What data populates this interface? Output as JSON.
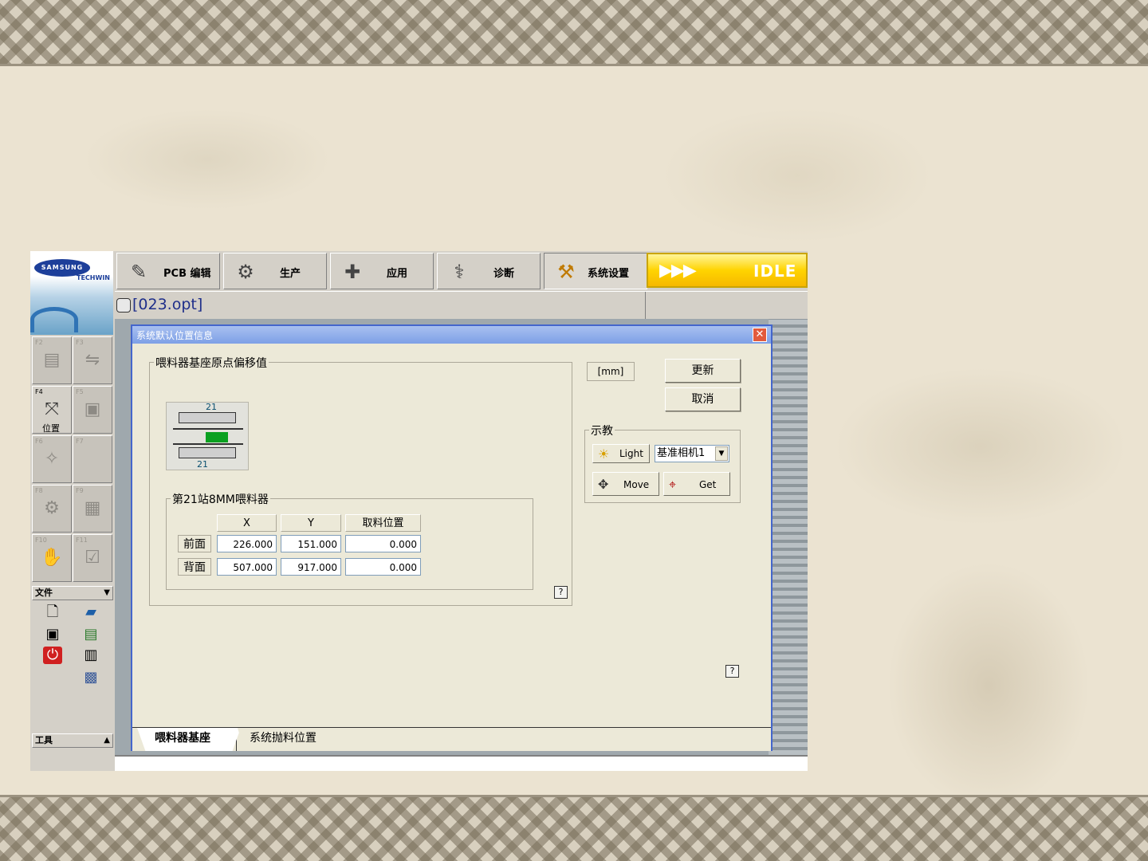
{
  "app": {
    "logo_brand": "SAMSUNG",
    "logo_sub": "TECHWIN",
    "file_name": "[023.opt]",
    "status": "IDLE"
  },
  "toolbar": {
    "items": [
      {
        "label": "PCB 编辑",
        "icon": "pcb-edit-icon"
      },
      {
        "label": "生产",
        "icon": "production-icon"
      },
      {
        "label": "应用",
        "icon": "application-icon"
      },
      {
        "label": "诊断",
        "icon": "diagnostics-icon"
      },
      {
        "label": "系统设置",
        "icon": "system-settings-icon"
      }
    ]
  },
  "fkeys": [
    {
      "key": "F2",
      "label": ""
    },
    {
      "key": "F3",
      "label": ""
    },
    {
      "key": "F4",
      "label": "位置"
    },
    {
      "key": "F5",
      "label": ""
    },
    {
      "key": "F6",
      "label": ""
    },
    {
      "key": "F7",
      "label": ""
    },
    {
      "key": "F8",
      "label": ""
    },
    {
      "key": "F9",
      "label": ""
    },
    {
      "key": "F10",
      "label": ""
    },
    {
      "key": "F11",
      "label": ""
    }
  ],
  "menus": {
    "file": "文件",
    "tools": "工具"
  },
  "dialog": {
    "title": "系统默认位置信息",
    "group_title": "喂料器基座原点偏移值",
    "diagram_label_top": "21",
    "diagram_label_bottom": "21",
    "station_group_title": "第21站8MM喂料器",
    "columns": [
      "X",
      "Y",
      "取料位置"
    ],
    "rows": [
      {
        "label": "前面",
        "x": "226.000",
        "y": "151.000",
        "pick": "0.000"
      },
      {
        "label": "背面",
        "x": "507.000",
        "y": "917.000",
        "pick": "0.000"
      }
    ],
    "unit": "[mm]",
    "update_button": "更新",
    "cancel_button": "取消",
    "teach_group": "示教",
    "light_button": "Light",
    "camera_select": "基准相机1",
    "move_button": "Move",
    "get_button": "Get",
    "help": "?",
    "tabs": [
      "喂料器基座",
      "系统抛料位置"
    ]
  },
  "colors": {
    "title_bar": "#7ea0e6",
    "idle_bg": "#ffd400",
    "file_name": "#1f2f8a",
    "feeder_green": "#0aa020"
  }
}
